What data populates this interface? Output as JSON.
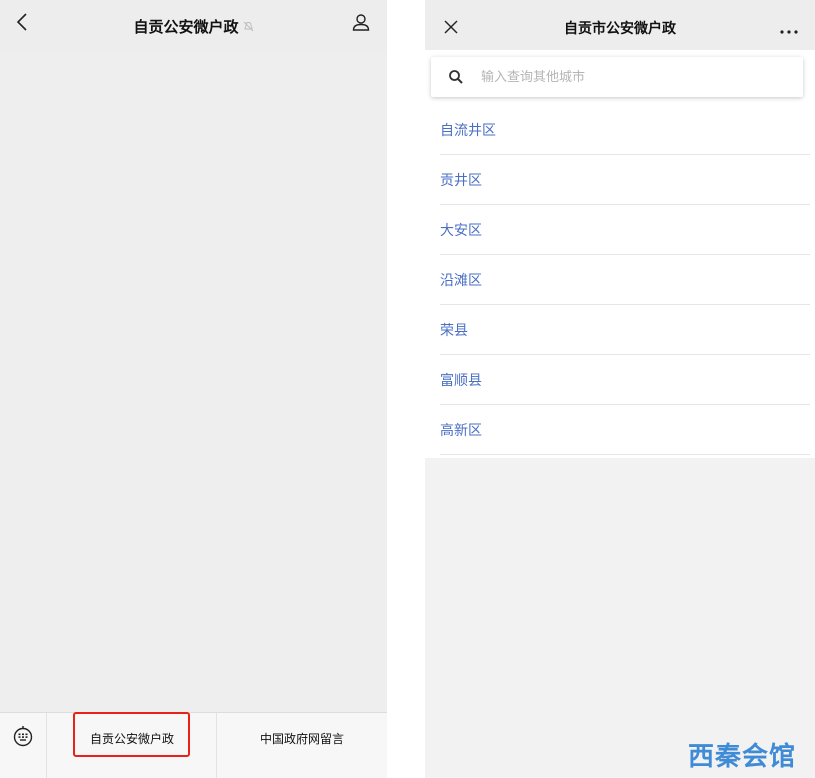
{
  "left": {
    "title": "自贡公安微户政",
    "menu": [
      {
        "label": "自贡公安微户政"
      },
      {
        "label": "中国政府网留言"
      }
    ]
  },
  "right": {
    "title": "自贡市公安微户政",
    "search": {
      "placeholder": "输入查询其他城市",
      "value": ""
    },
    "districts": [
      "自流井区",
      "贡井区",
      "大安区",
      "沿滩区",
      "荣县",
      "富顺县",
      "高新区"
    ]
  },
  "watermark": "西秦会馆",
  "icons": {
    "back": "chevron-left-icon",
    "mute": "bell-off-icon",
    "profile": "person-icon",
    "keyboard": "keyboard-icon",
    "close": "close-icon",
    "more": "more-icon",
    "search": "search-icon"
  },
  "colors": {
    "link": "#4a6fc4",
    "highlight": "#e8221b",
    "watermark": "#3f8bd6"
  }
}
